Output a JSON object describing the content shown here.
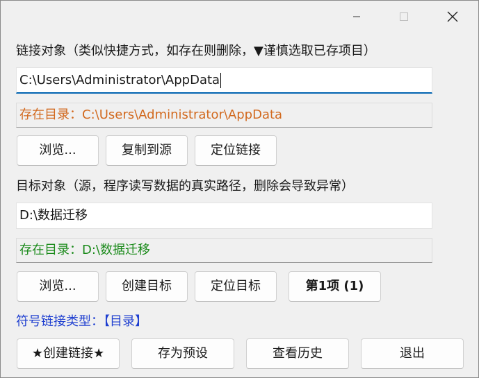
{
  "window": {
    "controls": {
      "minimize": "minimize",
      "maximize": "maximize",
      "close": "close"
    }
  },
  "link_section": {
    "label": "链接对象（类似快捷方式，如存在则删除，▼谨慎选取已存项目）",
    "input_value": "C:\\Users\\Administrator\\AppData",
    "status_text": "存在目录：C:\\Users\\Administrator\\AppData",
    "buttons": {
      "browse": "浏览...",
      "copy_to_source": "复制到源",
      "locate_link": "定位链接"
    }
  },
  "target_section": {
    "label": "目标对象（源，程序读写数据的真实路径，删除会导致异常）",
    "input_value": "D:\\数据迁移",
    "status_text": "存在目录：D:\\数据迁移",
    "buttons": {
      "browse": "浏览...",
      "create_target": "创建目标",
      "locate_target": "定位目标",
      "item_nav": "第1项 (1)"
    }
  },
  "symlink_type": "符号链接类型：【目录】",
  "footer": {
    "create_link": "★创建链接★",
    "save_preset": "存为预设",
    "view_history": "查看历史",
    "exit": "退出"
  },
  "colors": {
    "link_status": "#d2691e",
    "target_status": "#1a8a1a",
    "link_type": "#1f3fd0",
    "focus_accent": "#0063b1"
  }
}
